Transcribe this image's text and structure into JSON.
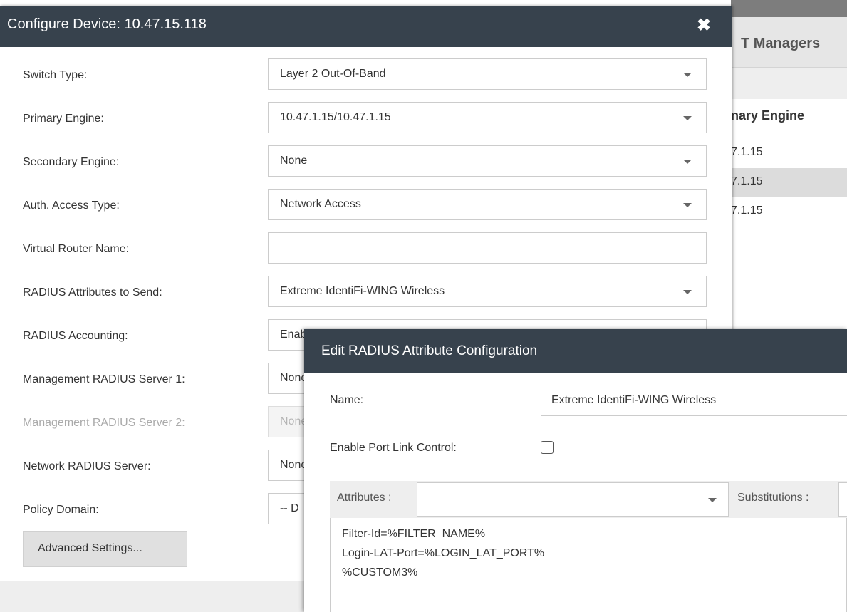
{
  "background": {
    "tab_label": "T Managers",
    "column_header": "nary Engine",
    "rows": [
      "7.1.15",
      "7.1.15",
      "7.1.15"
    ]
  },
  "configure_dialog": {
    "title": "Configure Device: 10.47.15.118",
    "close_icon": "close-icon",
    "fields": [
      {
        "label": "Switch Type:",
        "value": "Layer 2 Out-Of-Band",
        "type": "select"
      },
      {
        "label": "Primary Engine:",
        "value": "10.47.1.15/10.47.1.15",
        "type": "select"
      },
      {
        "label": "Secondary Engine:",
        "value": "None",
        "type": "select"
      },
      {
        "label": "Auth. Access Type:",
        "value": "Network Access",
        "type": "select"
      },
      {
        "label": "Virtual Router Name:",
        "value": "",
        "type": "text"
      },
      {
        "label": "RADIUS Attributes to Send:",
        "value": "Extreme IdentiFi-WING Wireless",
        "type": "select"
      },
      {
        "label": "RADIUS Accounting:",
        "value": "Enabled",
        "type": "select"
      },
      {
        "label": "Management RADIUS Server 1:",
        "value": "None",
        "type": "select"
      },
      {
        "label": "Management RADIUS Server 2:",
        "value": "None",
        "type": "select",
        "disabled": true
      },
      {
        "label": "Network RADIUS Server:",
        "value": "None",
        "type": "select"
      },
      {
        "label": "Policy Domain:",
        "value": "-- D",
        "type": "select"
      }
    ],
    "advanced_button": "Advanced Settings..."
  },
  "radius_dialog": {
    "title": "Edit RADIUS Attribute Configuration",
    "name_label": "Name:",
    "name_value": "Extreme IdentiFi-WING Wireless",
    "port_link_label": "Enable Port Link Control:",
    "port_link_checked": false,
    "attributes_label": "Attributes :",
    "attributes_value": "",
    "substitutions_label": "Substitutions :",
    "attribute_lines": [
      "Filter-Id=%FILTER_NAME%",
      "Login-LAT-Port=%LOGIN_LAT_PORT%",
      "%CUSTOM3%"
    ]
  },
  "colors": {
    "header_bg": "#37424d",
    "header_text": "#ffffff",
    "button_bg": "#e0e0e0"
  }
}
